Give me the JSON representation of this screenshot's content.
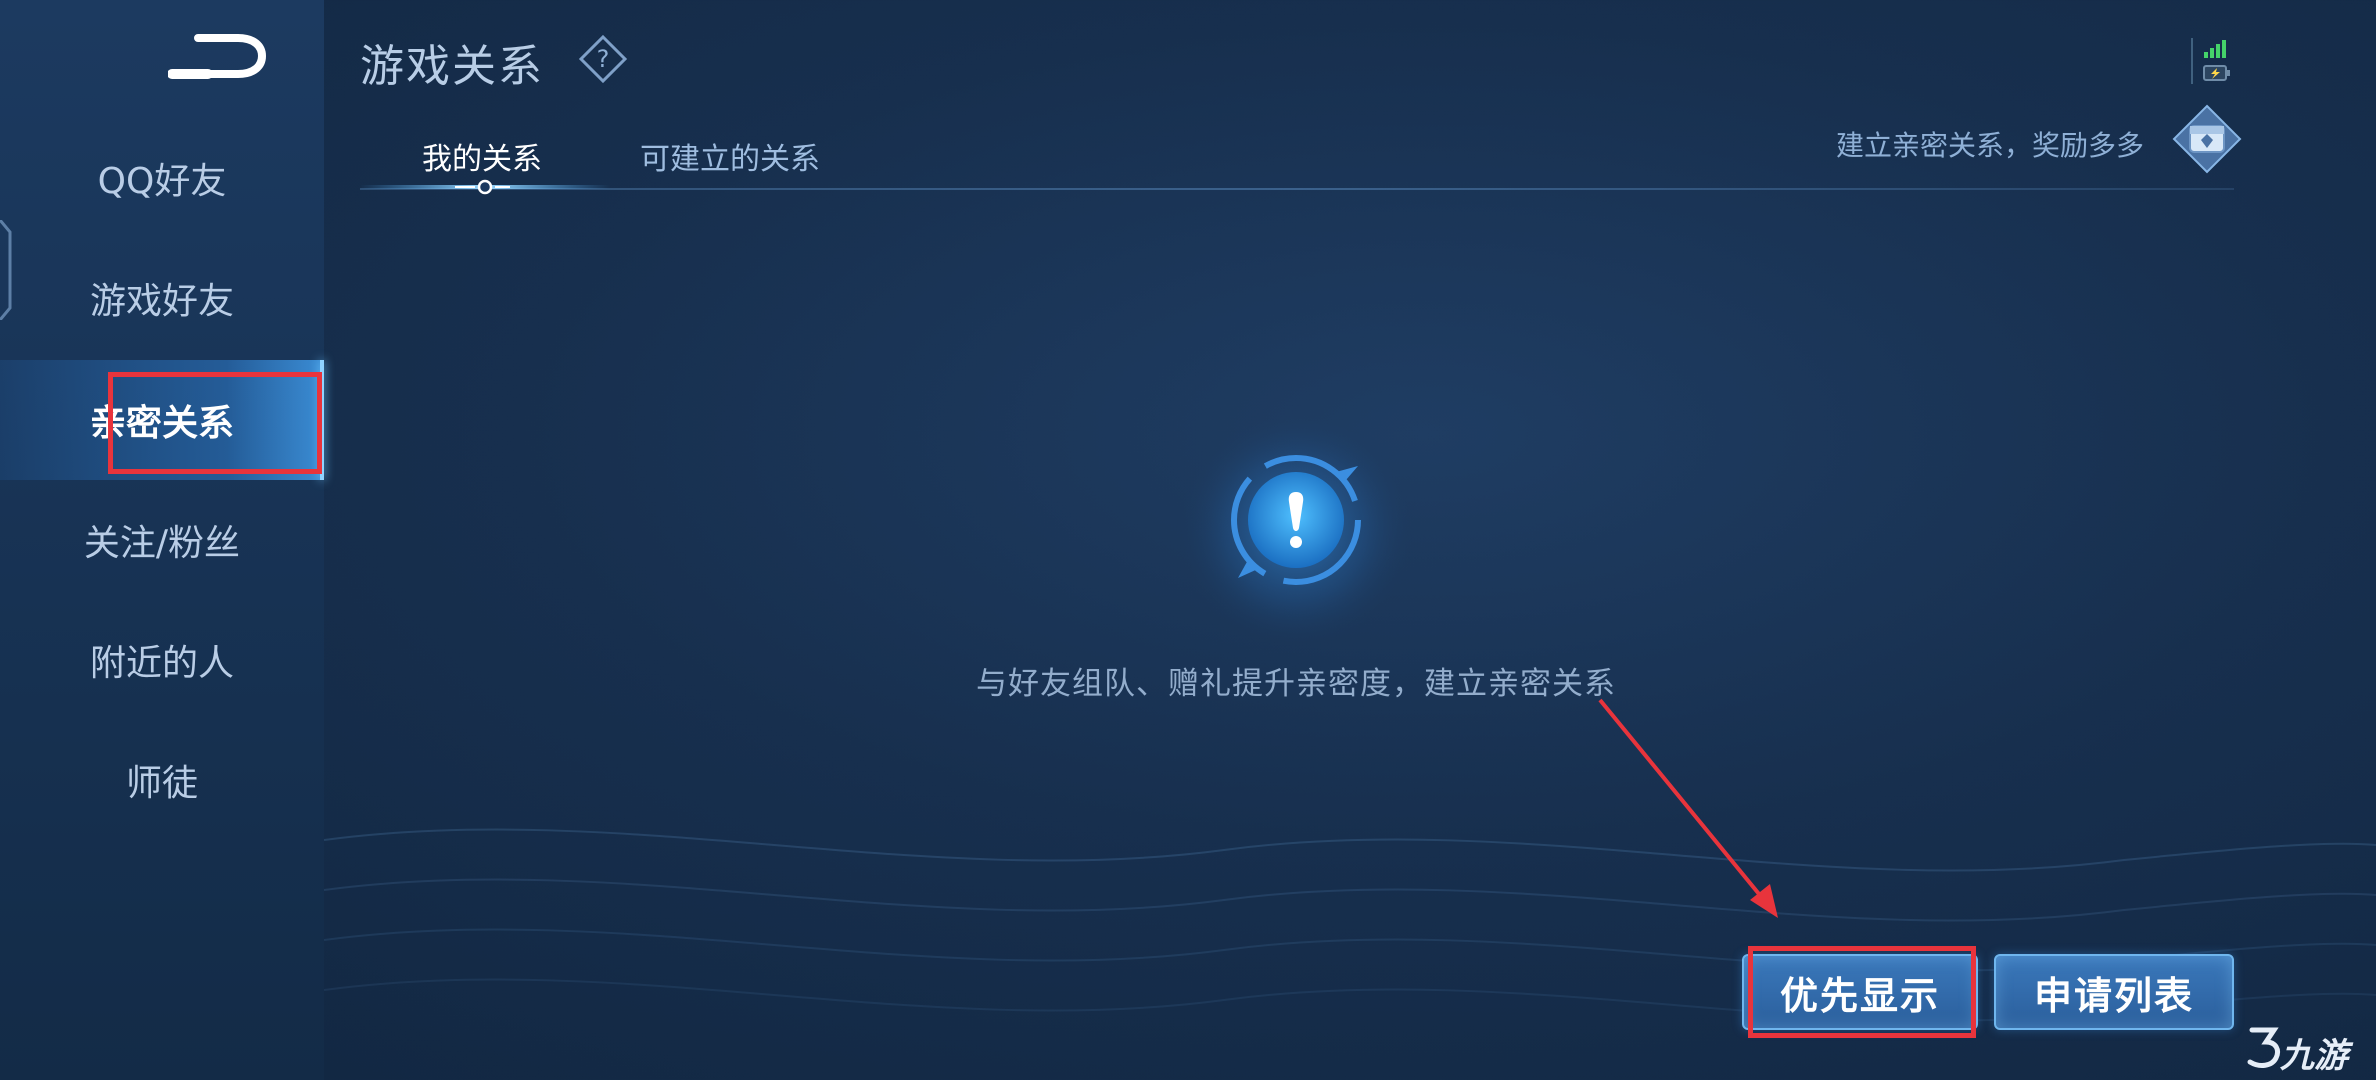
{
  "header": {
    "title": "游戏关系"
  },
  "sidebar": {
    "items": [
      {
        "label": "QQ好友"
      },
      {
        "label": "游戏好友"
      },
      {
        "label": "亲密关系"
      },
      {
        "label": "关注/粉丝"
      },
      {
        "label": "附近的人"
      },
      {
        "label": "师徒"
      }
    ],
    "active_index": 2
  },
  "tabs": [
    {
      "label": "我的关系",
      "active": true
    },
    {
      "label": "可建立的关系",
      "active": false
    }
  ],
  "promo": {
    "text": "建立亲密关系，奖励多多"
  },
  "empty_state": {
    "message": "与好友组队、赠礼提升亲密度，建立亲密关系"
  },
  "buttons": {
    "priority_display": "优先显示",
    "request_list": "申请列表"
  },
  "watermark": {
    "text": "九游"
  },
  "colors": {
    "highlight_box": "#e8343c",
    "accent": "#6ec8ff"
  }
}
